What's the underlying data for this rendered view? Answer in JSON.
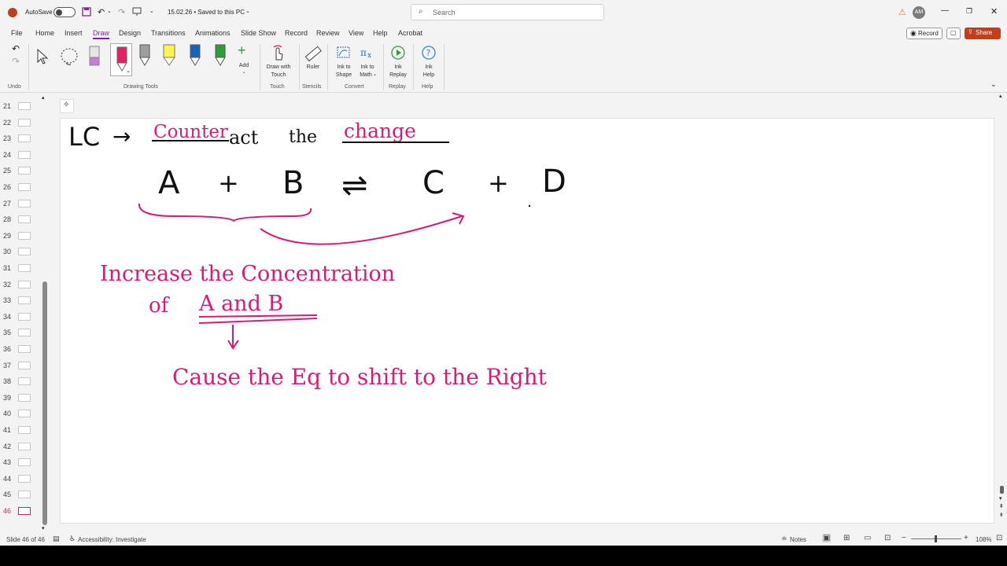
{
  "titlebar": {
    "autosave_label": "AutoSave",
    "autosave_state": "Off",
    "doc_status": "15.02.26 • Saved to this PC",
    "search_placeholder": "Search",
    "avatar_initials": "AM"
  },
  "tabs": [
    "File",
    "Home",
    "Insert",
    "Draw",
    "Design",
    "Transitions",
    "Animations",
    "Slide Show",
    "Record",
    "Review",
    "View",
    "Help",
    "Acrobat"
  ],
  "active_tab": "Draw",
  "ribbon_actions": {
    "record_label": "Record",
    "share_label": "Share"
  },
  "ribbon": {
    "undo_group": "Undo",
    "drawing_tools_group": "Drawing Tools",
    "add_label": "Add",
    "draw_with_touch": [
      "Draw with",
      "Touch"
    ],
    "touch_group": "Touch",
    "ruler_label": "Ruler",
    "stencils_group": "Stencils",
    "ink_to_shape": [
      "Ink to",
      "Shape"
    ],
    "ink_to_math": [
      "Ink to",
      "Math"
    ],
    "convert_group": "Convert",
    "ink_replay": [
      "Ink",
      "Replay"
    ],
    "replay_group": "Replay",
    "ink_help": [
      "Ink",
      "Help"
    ],
    "help_group": "Help"
  },
  "colors": {
    "accent": "#7a2a8c",
    "ink_pink": "#d81b74",
    "share_red": "#c43e1c",
    "active_slide": "#c0305a"
  },
  "thumbnails": [
    "21",
    "22",
    "23",
    "24",
    "25",
    "26",
    "27",
    "28",
    "29",
    "30",
    "31",
    "32",
    "33",
    "34",
    "35",
    "36",
    "37",
    "38",
    "39",
    "40",
    "41",
    "42",
    "43",
    "44",
    "45",
    "46"
  ],
  "active_slide": "46",
  "slide": {
    "line1_black_1": "LC",
    "line1_arrow": "→",
    "line1_pink_1": "Counter",
    "line1_black_2": "act",
    "line1_black_3": "the",
    "line1_pink_2": "change",
    "eq_A": "A",
    "eq_plus1": "+",
    "eq_B": "B",
    "eq_arrow": "⇌",
    "eq_C": "C",
    "eq_plus2": "+",
    "eq_D": "D",
    "pink_line1": "Increase the Concentration",
    "pink_line2_of": "of",
    "pink_line2_ab": "A and B",
    "pink_line3": "Cause the Eq to shift to the Right"
  },
  "status": {
    "slide_counter": "Slide 46 of 46",
    "accessibility": "Accessibility: Investigate",
    "notes": "Notes",
    "zoom": "108%"
  }
}
